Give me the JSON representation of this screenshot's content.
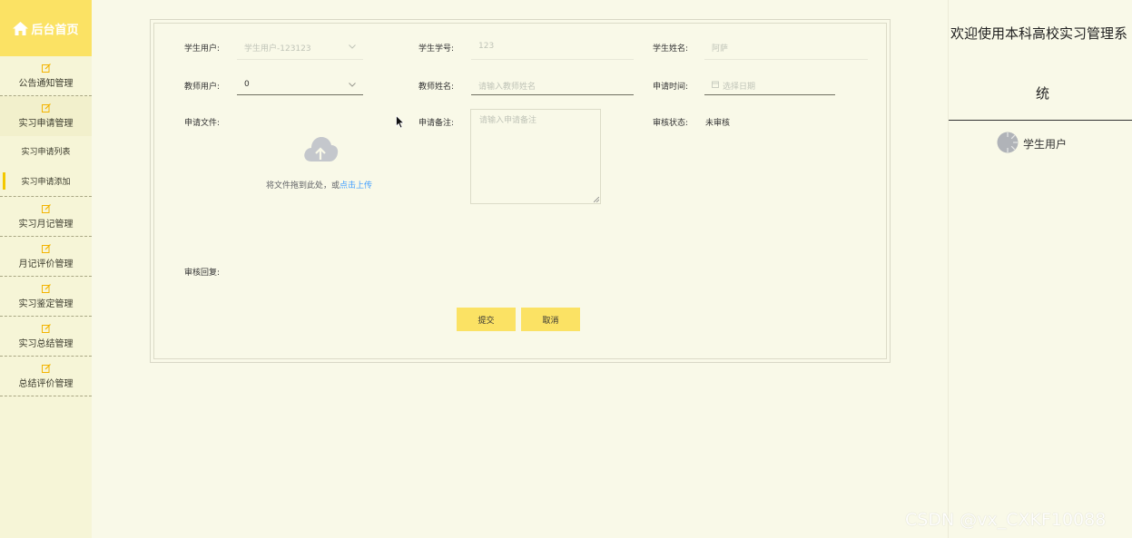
{
  "sidebar": {
    "brand": "后台首页",
    "menu": [
      {
        "label": "公告通知管理"
      },
      {
        "label": "实习申请管理"
      },
      {
        "label": "实习月记管理"
      },
      {
        "label": "月记评价管理"
      },
      {
        "label": "实习鉴定管理"
      },
      {
        "label": "实习总结管理"
      },
      {
        "label": "总结评价管理"
      }
    ],
    "submenu": [
      {
        "label": "实习申请列表"
      },
      {
        "label": "实习申请添加"
      }
    ]
  },
  "form": {
    "student_user": {
      "label": "学生用户:",
      "value": "学生用户-123123"
    },
    "student_no": {
      "label": "学生学号:",
      "value": "123"
    },
    "student_name": {
      "label": "学生姓名:",
      "value": "阿萨"
    },
    "teacher_user": {
      "label": "教师用户:",
      "value": "0"
    },
    "teacher_name": {
      "label": "教师姓名:",
      "placeholder": "请输入教师姓名"
    },
    "apply_time": {
      "label": "申请时间:",
      "placeholder": "选择日期"
    },
    "apply_file": {
      "label": "申请文件:",
      "upload_text": "将文件拖到此处，或",
      "upload_link": "点击上传"
    },
    "apply_remark": {
      "label": "申请备注:",
      "placeholder": "请输入申请备注"
    },
    "audit_status": {
      "label": "审核状态:",
      "value": "未审核"
    },
    "audit_reply": {
      "label": "审核回复:"
    },
    "submit": "提交",
    "cancel": "取消"
  },
  "right_panel": {
    "welcome_line1": "欢迎使用本科高校实习管理系",
    "welcome_line2": "统",
    "user": "学生用户"
  },
  "watermark": "CSDN @vx_CXKF10088"
}
